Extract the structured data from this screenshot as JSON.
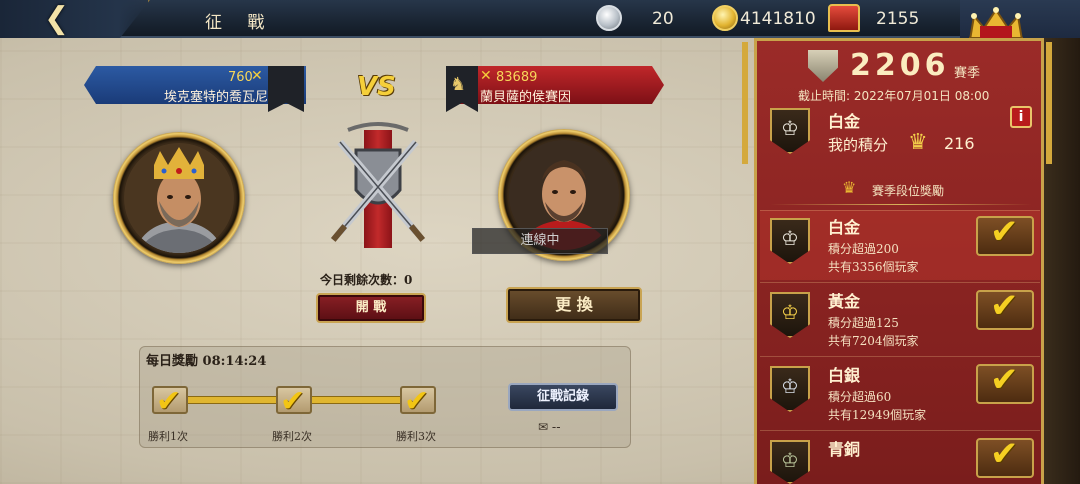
{
  "topbar": {
    "title": "征 戰",
    "back_icon": "back-arrow-icon",
    "silver_count": "20",
    "gold_count": "4141810",
    "crown_count": "2155"
  },
  "left_player": {
    "power": "760",
    "name": "埃克塞特的喬瓦尼"
  },
  "right_player": {
    "power": "83689",
    "name": "蘭貝薩的侯賽因",
    "status": "連線中"
  },
  "vs": "VS",
  "center": {
    "remaining": "今日剩餘次數：0",
    "fight_label": "開 戰",
    "change_label": "更 換"
  },
  "daily": {
    "title": "每日獎勵 08:14:24",
    "steps": [
      "勝利1次",
      "勝利2次",
      "勝利3次"
    ],
    "record_label": "征戰記錄",
    "record_value": "--"
  },
  "season": {
    "score": "2206",
    "season_label": "賽季",
    "deadline": "截止時間: 2022年07月01日 08:00",
    "current_tier": "白金",
    "my_score_label": "我的積分",
    "my_score": "216",
    "rewards_header": "賽季段位獎勵",
    "info": "i",
    "tiers": [
      {
        "name": "白金",
        "req": "積分超過200",
        "players": "共有3356個玩家"
      },
      {
        "name": "黃金",
        "req": "積分超過125",
        "players": "共有7204個玩家"
      },
      {
        "name": "白銀",
        "req": "積分超過60",
        "players": "共有12949個玩家"
      },
      {
        "name": "青銅",
        "req": "",
        "players": ""
      }
    ]
  },
  "colors": {
    "accent_gold": "#c8a24a",
    "panel_red": "#9b2b28",
    "left_banner": "#2c5aa3",
    "right_banner": "#c0272a"
  }
}
